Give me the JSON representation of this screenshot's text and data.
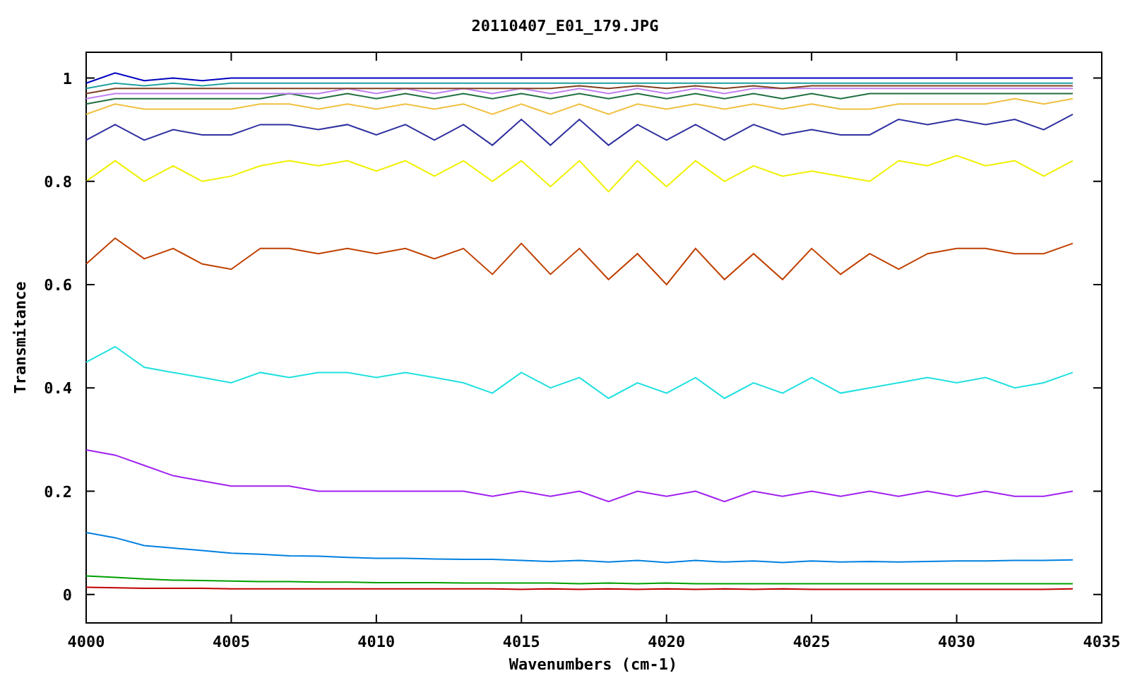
{
  "chart": {
    "chart_data": {
      "type": "line",
      "title": "20110407_E01_179.JPG",
      "xlabel": "Wavenumbers (cm-1)",
      "ylabel": "Transmitance",
      "xlim": [
        4000,
        4035
      ],
      "ylim": [
        -0.055,
        1.05
      ],
      "xticks": [
        4000,
        4005,
        4010,
        4015,
        4020,
        4025,
        4030,
        4035
      ],
      "yticks": [
        0,
        0.2,
        0.4,
        0.6,
        0.8,
        1
      ],
      "x": [
        4000,
        4001,
        4002,
        4003,
        4004,
        4005,
        4006,
        4007,
        4008,
        4009,
        4010,
        4011,
        4012,
        4013,
        4014,
        4015,
        4016,
        4017,
        4018,
        4019,
        4020,
        4021,
        4022,
        4023,
        4024,
        4025,
        4026,
        4027,
        4028,
        4029,
        4030,
        4031,
        4032,
        4033,
        4034
      ],
      "series": [
        {
          "color": "#c00000",
          "values": [
            0.014,
            0.013,
            0.012,
            0.012,
            0.012,
            0.011,
            0.011,
            0.011,
            0.011,
            0.011,
            0.011,
            0.011,
            0.011,
            0.011,
            0.011,
            0.01,
            0.011,
            0.01,
            0.011,
            0.01,
            0.011,
            0.01,
            0.011,
            0.01,
            0.011,
            0.01,
            0.01,
            0.01,
            0.01,
            0.01,
            0.01,
            0.01,
            0.01,
            0.01,
            0.011
          ]
        },
        {
          "color": "#00a000",
          "values": [
            0.036,
            0.033,
            0.03,
            0.028,
            0.027,
            0.026,
            0.025,
            0.025,
            0.024,
            0.024,
            0.023,
            0.023,
            0.023,
            0.022,
            0.022,
            0.022,
            0.022,
            0.021,
            0.022,
            0.021,
            0.022,
            0.021,
            0.021,
            0.021,
            0.021,
            0.021,
            0.021,
            0.021,
            0.021,
            0.021,
            0.021,
            0.021,
            0.021,
            0.021,
            0.021
          ]
        },
        {
          "color": "#0080e0",
          "values": [
            0.12,
            0.11,
            0.095,
            0.09,
            0.085,
            0.08,
            0.078,
            0.075,
            0.074,
            0.072,
            0.07,
            0.07,
            0.069,
            0.068,
            0.068,
            0.066,
            0.064,
            0.066,
            0.063,
            0.066,
            0.062,
            0.066,
            0.063,
            0.065,
            0.062,
            0.065,
            0.063,
            0.064,
            0.063,
            0.064,
            0.065,
            0.065,
            0.066,
            0.066,
            0.067
          ]
        },
        {
          "color": "#a020f0",
          "values": [
            0.28,
            0.27,
            0.25,
            0.23,
            0.22,
            0.21,
            0.21,
            0.21,
            0.2,
            0.2,
            0.2,
            0.2,
            0.2,
            0.2,
            0.19,
            0.2,
            0.19,
            0.2,
            0.18,
            0.2,
            0.19,
            0.2,
            0.18,
            0.2,
            0.19,
            0.2,
            0.19,
            0.2,
            0.19,
            0.2,
            0.19,
            0.2,
            0.19,
            0.19,
            0.2
          ]
        },
        {
          "color": "#20e0e0",
          "values": [
            0.45,
            0.48,
            0.44,
            0.43,
            0.42,
            0.41,
            0.43,
            0.42,
            0.43,
            0.43,
            0.42,
            0.43,
            0.42,
            0.41,
            0.39,
            0.43,
            0.4,
            0.42,
            0.38,
            0.41,
            0.39,
            0.42,
            0.38,
            0.41,
            0.39,
            0.42,
            0.39,
            0.4,
            0.41,
            0.42,
            0.41,
            0.42,
            0.4,
            0.41,
            0.43
          ]
        },
        {
          "color": "#c04000",
          "values": [
            0.64,
            0.69,
            0.65,
            0.67,
            0.64,
            0.63,
            0.67,
            0.67,
            0.66,
            0.67,
            0.66,
            0.67,
            0.65,
            0.67,
            0.62,
            0.68,
            0.62,
            0.67,
            0.61,
            0.66,
            0.6,
            0.67,
            0.61,
            0.66,
            0.61,
            0.67,
            0.62,
            0.66,
            0.63,
            0.66,
            0.67,
            0.67,
            0.66,
            0.66,
            0.68
          ]
        },
        {
          "color": "#f0f000",
          "values": [
            0.8,
            0.84,
            0.8,
            0.83,
            0.8,
            0.81,
            0.83,
            0.84,
            0.83,
            0.84,
            0.82,
            0.84,
            0.81,
            0.84,
            0.8,
            0.84,
            0.79,
            0.84,
            0.78,
            0.84,
            0.79,
            0.84,
            0.8,
            0.83,
            0.81,
            0.82,
            0.81,
            0.8,
            0.84,
            0.83,
            0.85,
            0.83,
            0.84,
            0.81,
            0.84
          ]
        },
        {
          "color": "#3030a0",
          "values": [
            0.88,
            0.91,
            0.88,
            0.9,
            0.89,
            0.89,
            0.91,
            0.91,
            0.9,
            0.91,
            0.89,
            0.91,
            0.88,
            0.91,
            0.87,
            0.92,
            0.87,
            0.92,
            0.87,
            0.91,
            0.88,
            0.91,
            0.88,
            0.91,
            0.89,
            0.9,
            0.89,
            0.89,
            0.92,
            0.91,
            0.92,
            0.91,
            0.92,
            0.9,
            0.93
          ]
        },
        {
          "color": "#f0c040",
          "values": [
            0.93,
            0.95,
            0.94,
            0.94,
            0.94,
            0.94,
            0.95,
            0.95,
            0.94,
            0.95,
            0.94,
            0.95,
            0.94,
            0.95,
            0.93,
            0.95,
            0.93,
            0.95,
            0.93,
            0.95,
            0.94,
            0.95,
            0.94,
            0.95,
            0.94,
            0.95,
            0.94,
            0.94,
            0.95,
            0.95,
            0.95,
            0.95,
            0.96,
            0.95,
            0.96
          ]
        },
        {
          "color": "#207040",
          "values": [
            0.95,
            0.96,
            0.96,
            0.96,
            0.96,
            0.96,
            0.96,
            0.97,
            0.96,
            0.97,
            0.96,
            0.97,
            0.96,
            0.97,
            0.96,
            0.97,
            0.96,
            0.97,
            0.96,
            0.97,
            0.96,
            0.97,
            0.96,
            0.97,
            0.96,
            0.97,
            0.96,
            0.97,
            0.97,
            0.97,
            0.97,
            0.97,
            0.97,
            0.97,
            0.97
          ]
        },
        {
          "color": "#c080f0",
          "values": [
            0.96,
            0.97,
            0.97,
            0.97,
            0.97,
            0.97,
            0.97,
            0.97,
            0.97,
            0.98,
            0.97,
            0.98,
            0.97,
            0.98,
            0.97,
            0.98,
            0.97,
            0.98,
            0.97,
            0.98,
            0.97,
            0.98,
            0.97,
            0.98,
            0.98,
            0.98,
            0.98,
            0.98,
            0.98,
            0.98,
            0.98,
            0.98,
            0.98,
            0.98,
            0.98
          ]
        },
        {
          "color": "#804020",
          "values": [
            0.97,
            0.98,
            0.98,
            0.98,
            0.98,
            0.98,
            0.98,
            0.98,
            0.98,
            0.98,
            0.98,
            0.98,
            0.98,
            0.98,
            0.98,
            0.98,
            0.98,
            0.985,
            0.98,
            0.985,
            0.98,
            0.985,
            0.98,
            0.985,
            0.98,
            0.985,
            0.985,
            0.985,
            0.985,
            0.985,
            0.985,
            0.985,
            0.985,
            0.985,
            0.985
          ]
        },
        {
          "color": "#20a0a0",
          "values": [
            0.98,
            0.99,
            0.985,
            0.99,
            0.985,
            0.99,
            0.99,
            0.99,
            0.99,
            0.99,
            0.99,
            0.99,
            0.99,
            0.99,
            0.99,
            0.99,
            0.99,
            0.99,
            0.99,
            0.99,
            0.99,
            0.99,
            0.99,
            0.99,
            0.99,
            0.99,
            0.99,
            0.99,
            0.99,
            0.99,
            0.99,
            0.99,
            0.99,
            0.99,
            0.99
          ]
        },
        {
          "color": "#0000c0",
          "values": [
            0.99,
            1.01,
            0.995,
            1.0,
            0.995,
            1.0,
            1.0,
            1.0,
            1.0,
            1.0,
            1.0,
            1.0,
            1.0,
            1.0,
            1.0,
            1.0,
            1.0,
            1.0,
            1.0,
            1.0,
            1.0,
            1.0,
            1.0,
            1.0,
            1.0,
            1.0,
            1.0,
            1.0,
            1.0,
            1.0,
            1.0,
            1.0,
            1.0,
            1.0,
            1.0
          ]
        }
      ]
    }
  }
}
